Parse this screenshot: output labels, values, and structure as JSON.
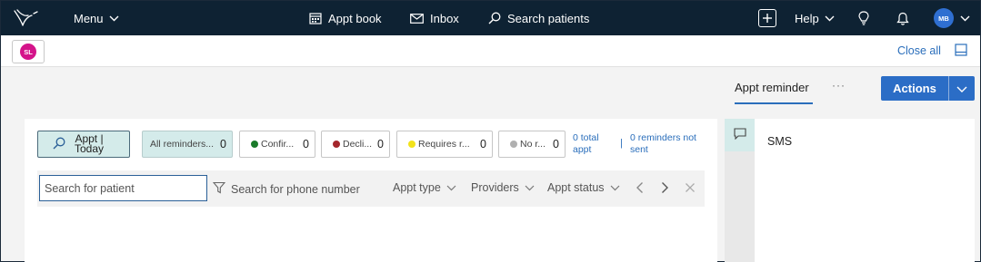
{
  "topbar": {
    "menu_label": "Menu",
    "appt_book_label": "Appt book",
    "inbox_label": "Inbox",
    "search_label": "Search patients",
    "help_label": "Help",
    "user_initials": "MB"
  },
  "subbar": {
    "patient_initials": "SL",
    "close_all_label": "Close all"
  },
  "tabs": {
    "active_label": "Appt reminder",
    "more_label": "···"
  },
  "actions": {
    "label": "Actions"
  },
  "reminders": {
    "appt_today_line1": "Appt |",
    "appt_today_line2": "Today",
    "chips": [
      {
        "label": "All reminders...",
        "count": "0"
      },
      {
        "label": "Confir...",
        "count": "0",
        "dot_color": "#1a7a2a"
      },
      {
        "label": "Decli...",
        "count": "0",
        "dot_color": "#a4262c"
      },
      {
        "label": "Requires r...",
        "count": "0",
        "dot_color": "#f2e21a"
      },
      {
        "label": "No r...",
        "count": "0",
        "dot_color": "#b0b0b0"
      }
    ],
    "total_appt_label": "0 total appt",
    "separator": "|",
    "not_sent_label": "0 reminders not sent"
  },
  "filters": {
    "patient_placeholder": "Search for patient",
    "phone_label": "Search for phone number",
    "appt_type_label": "Appt type",
    "providers_label": "Providers",
    "appt_status_label": "Appt status"
  },
  "side_panel": {
    "sms_label": "SMS"
  },
  "colors": {
    "topbar_bg": "#0e2233",
    "accent": "#2b6dc6",
    "selected_bg": "#d4ebea",
    "avatar_patient": "#d4148a",
    "avatar_user": "#2f6fd1"
  }
}
